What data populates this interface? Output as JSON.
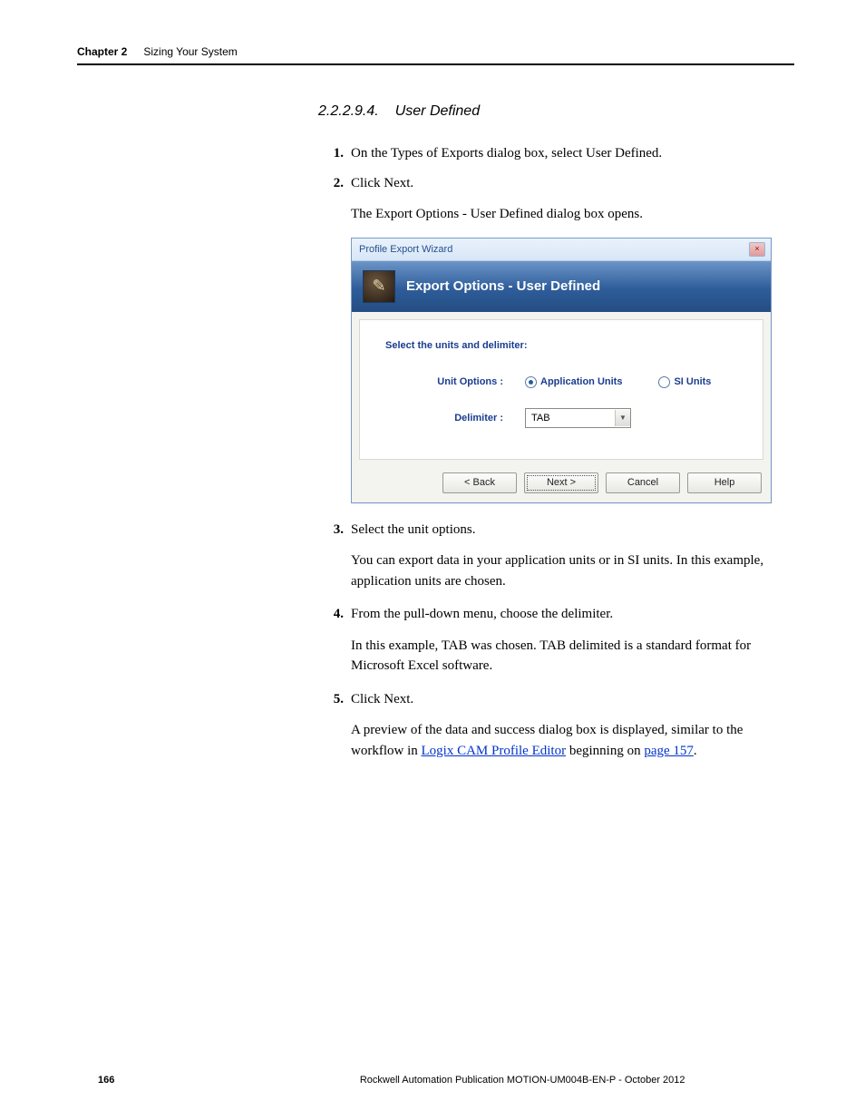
{
  "header": {
    "chapter": "Chapter 2",
    "title": "Sizing Your System"
  },
  "section": {
    "number": "2.2.2.9.4.",
    "title": "User Defined"
  },
  "steps": {
    "s1": {
      "num": "1.",
      "text": "On the Types of Exports dialog box, select User Defined."
    },
    "s2": {
      "num": "2.",
      "text": "Click Next."
    },
    "s2_sub": "The Export Options - User Defined dialog box opens.",
    "s3": {
      "num": "3.",
      "text": "Select the unit options."
    },
    "s3_sub": "You can export data in your application units or in SI units. In this example, application units are chosen.",
    "s4": {
      "num": "4.",
      "text": "From the pull-down menu, choose the delimiter."
    },
    "s4_sub": "In this example, TAB was chosen. TAB delimited is a standard format for Microsoft Excel software.",
    "s5": {
      "num": "5.",
      "text": "Click Next."
    },
    "s5_sub_a": "A preview of the data and success dialog box is displayed, similar to the workflow in ",
    "s5_link1": "Logix CAM Profile Editor",
    "s5_sub_b": " beginning on ",
    "s5_link2": "page 157",
    "s5_sub_c": "."
  },
  "dialog": {
    "window_title": "Profile Export Wizard",
    "banner_title": "Export Options - User Defined",
    "instruction": "Select the units and delimiter:",
    "unit_label": "Unit Options :",
    "radio_app": "Application Units",
    "radio_si": "SI Units",
    "delim_label": "Delimiter :",
    "delim_value": "TAB",
    "buttons": {
      "back": "< Back",
      "next": "Next >",
      "cancel": "Cancel",
      "help": "Help"
    }
  },
  "footer": {
    "page": "166",
    "publication": "Rockwell Automation Publication MOTION-UM004B-EN-P - October 2012"
  }
}
